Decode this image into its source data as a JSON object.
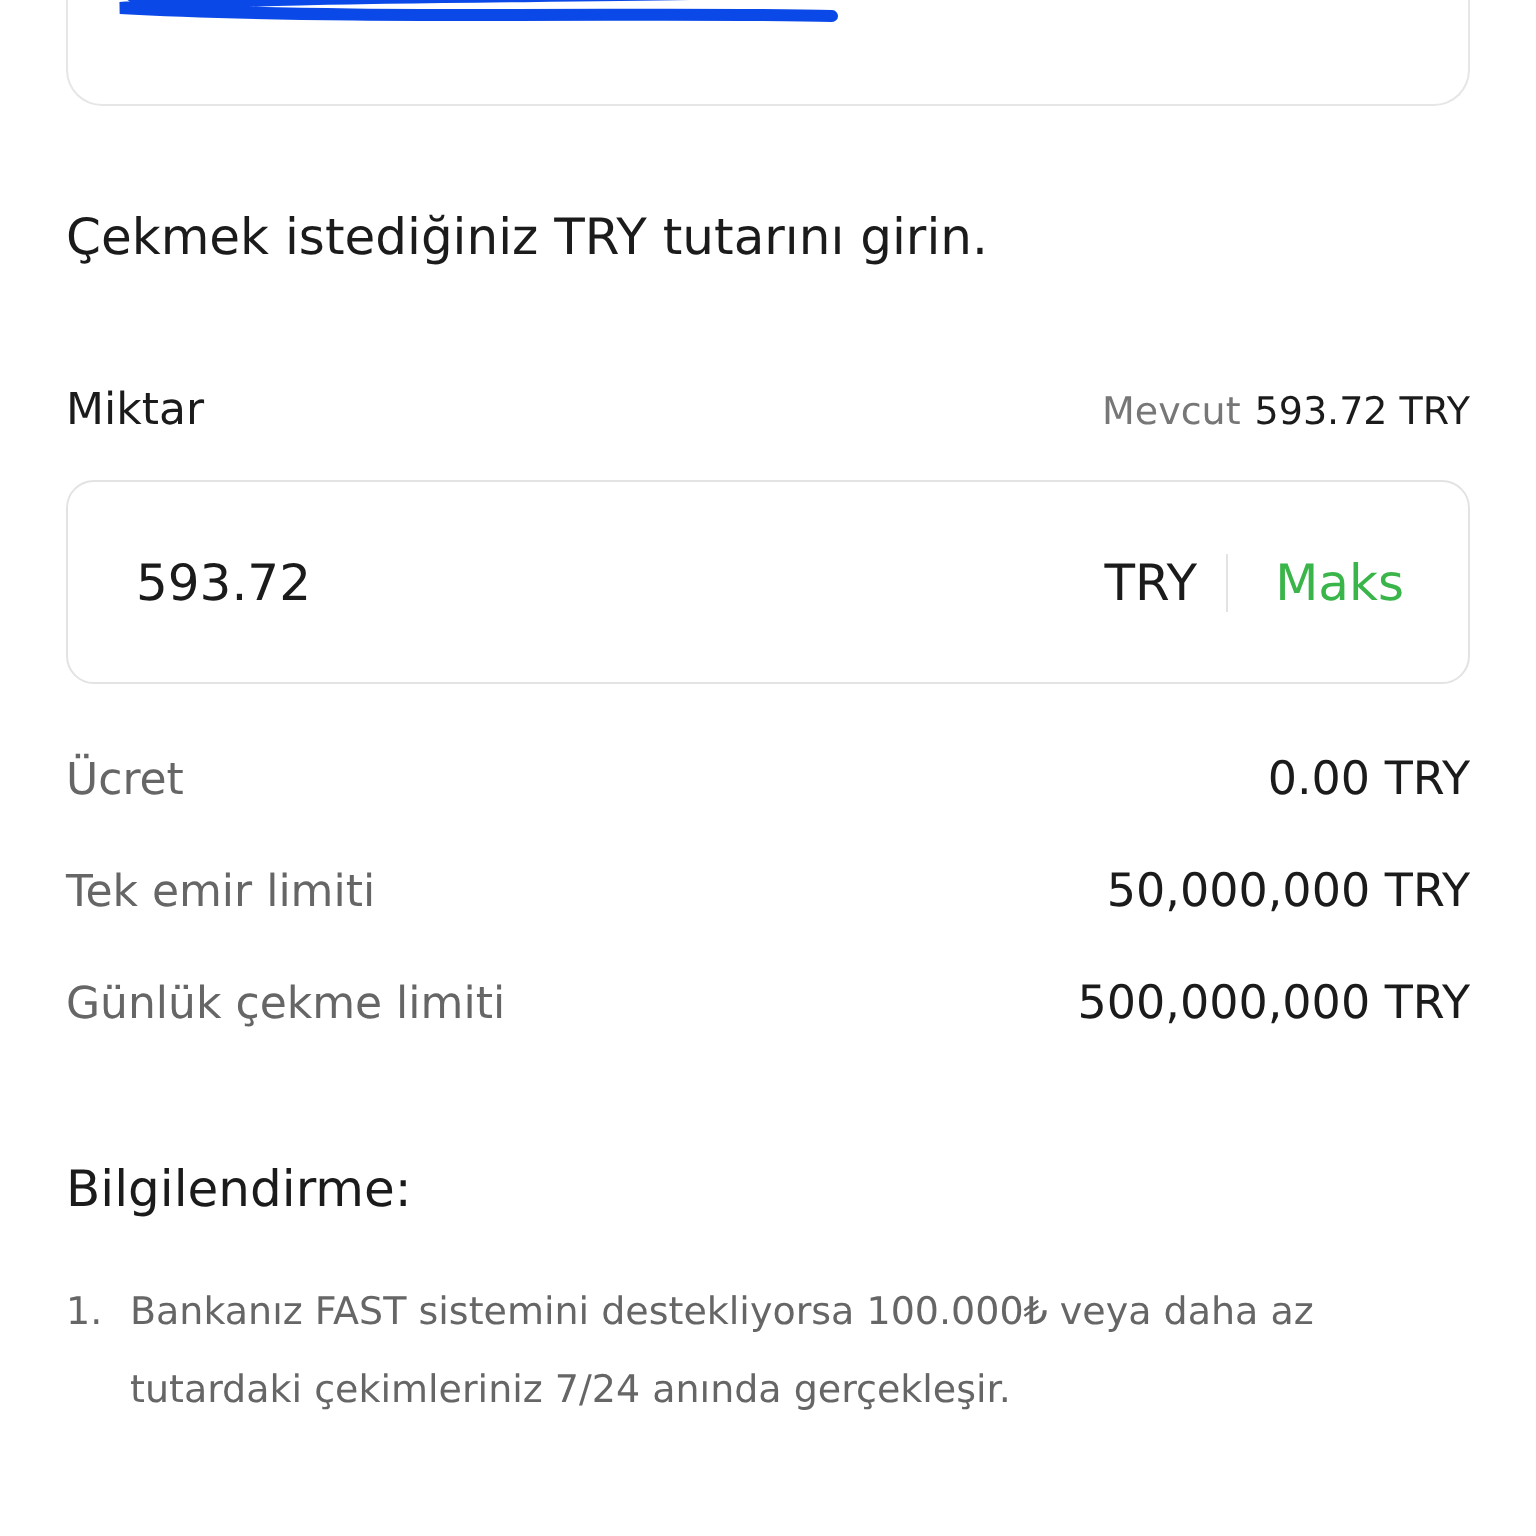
{
  "heading": "Çekmek istediğiniz TRY tutarını girin.",
  "amount": {
    "label": "Miktar",
    "available_label": "Mevcut",
    "available_value": "593.72 TRY",
    "value": "593.72",
    "currency": "TRY",
    "max_button": "Maks"
  },
  "details": [
    {
      "label": "Ücret",
      "value": "0.00 TRY"
    },
    {
      "label": "Tek emir limiti",
      "value": "50,000,000 TRY"
    },
    {
      "label": "Günlük çekme limiti",
      "value": "500,000,000 TRY"
    }
  ],
  "info": {
    "title": "Bilgilendirme:",
    "items": [
      {
        "number": "1.",
        "text": "Bankanız FAST sistemini destekliyorsa 100.000₺ veya daha az tutardaki çekimleriniz 7/24 anında gerçekleşir."
      }
    ]
  }
}
